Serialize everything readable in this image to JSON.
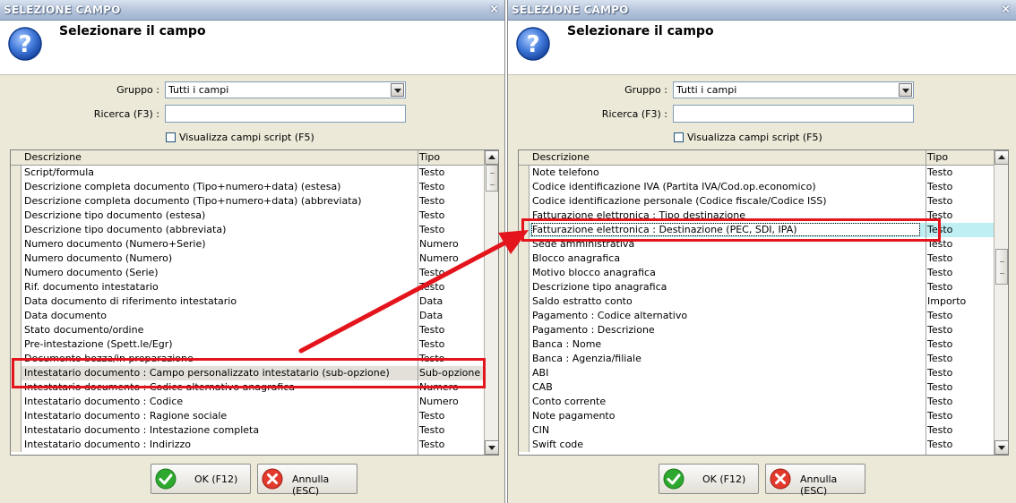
{
  "dialogs": [
    {
      "title": "SELEZIONE CAMPO",
      "close": "×",
      "header_title": "Selezionare il campo",
      "group_label": "Gruppo :",
      "group_value": "Tutti i campi",
      "search_label": "Ricerca (F3) :",
      "search_value": "",
      "script_checkbox_label": "Visualizza campi script (F5)",
      "columns": [
        "Descrizione",
        "Tipo"
      ],
      "rows": [
        [
          "Script/formula",
          "Testo"
        ],
        [
          "Descrizione completa documento (Tipo+numero+data) (estesa)",
          "Testo"
        ],
        [
          "Descrizione completa documento (Tipo+numero+data) (abbreviata)",
          "Testo"
        ],
        [
          "Descrizione tipo documento (estesa)",
          "Testo"
        ],
        [
          "Descrizione tipo documento (abbreviata)",
          "Testo"
        ],
        [
          "Numero documento (Numero+Serie)",
          "Numero"
        ],
        [
          "Numero documento (Numero)",
          "Numero"
        ],
        [
          "Numero documento (Serie)",
          "Testo"
        ],
        [
          "Rif. documento intestatario",
          "Testo"
        ],
        [
          "Data documento di riferimento intestatario",
          "Data"
        ],
        [
          "Data documento",
          "Data"
        ],
        [
          "Stato documento/ordine",
          "Testo"
        ],
        [
          "Pre-intestazione (Spett.le/Egr)",
          "Testo"
        ],
        [
          "Documento bozza/in preparazione",
          "Testo"
        ],
        [
          "Intestatario documento : Campo personalizzato intestatario (sub-opzione)",
          "Sub-opzione"
        ],
        [
          "Intestatario documento : Codice alternativo anagrafica",
          "Numero"
        ],
        [
          "Intestatario documento : Codice",
          "Numero"
        ],
        [
          "Intestatario documento : Ragione sociale",
          "Testo"
        ],
        [
          "Intestatario documento : Intestazione completa",
          "Testo"
        ],
        [
          "Intestatario documento : Indirizzo",
          "Testo"
        ]
      ],
      "selected_row": 14,
      "scroll_fraction": 0.0,
      "ok_label": "OK (F12)",
      "cancel_label": "Annulla (ESC)"
    },
    {
      "title": "SELEZIONE CAMPO",
      "close": "×",
      "header_title": "Selezionare il campo",
      "group_label": "Gruppo :",
      "group_value": "Tutti i campi",
      "search_label": "Ricerca (F3) :",
      "search_value": "",
      "script_checkbox_label": "Visualizza campi script (F5)",
      "columns": [
        "Descrizione",
        "Tipo"
      ],
      "rows": [
        [
          "Note telefono",
          "Testo"
        ],
        [
          "Codice identificazione IVA (Partita IVA/Cod.op.economico)",
          "Testo"
        ],
        [
          "Codice identificazione personale (Codice fiscale/Codice ISS)",
          "Testo"
        ],
        [
          "Fatturazione elettronica : Tipo destinazione",
          "Testo"
        ],
        [
          "Fatturazione elettronica : Destinazione (PEC, SDI, IPA)",
          "Testo"
        ],
        [
          "Sede amministrativa",
          "Testo"
        ],
        [
          "Blocco anagrafica",
          "Testo"
        ],
        [
          "Motivo blocco anagrafica",
          "Testo"
        ],
        [
          "Descrizione tipo anagrafica",
          "Testo"
        ],
        [
          "Saldo estratto conto",
          "Importo"
        ],
        [
          "Pagamento : Codice alternativo",
          "Testo"
        ],
        [
          "Pagamento : Descrizione",
          "Testo"
        ],
        [
          "Banca : Nome",
          "Testo"
        ],
        [
          "Banca : Agenzia/filiale",
          "Testo"
        ],
        [
          "ABI",
          "Testo"
        ],
        [
          "CAB",
          "Testo"
        ],
        [
          "Conto corrente",
          "Testo"
        ],
        [
          "Note pagamento",
          "Testo"
        ],
        [
          "CIN",
          "Testo"
        ],
        [
          "Swift code",
          "Testo"
        ]
      ],
      "selected_row": 4,
      "scroll_fraction": 0.35,
      "ok_label": "OK (F12)",
      "cancel_label": "Annulla (ESC)"
    }
  ],
  "colors": {
    "highlight_box": "#e4141c",
    "arrow": "#e4141c",
    "selected_row_left": "#e2e0d8",
    "selected_row_right": "#bfeff3"
  }
}
